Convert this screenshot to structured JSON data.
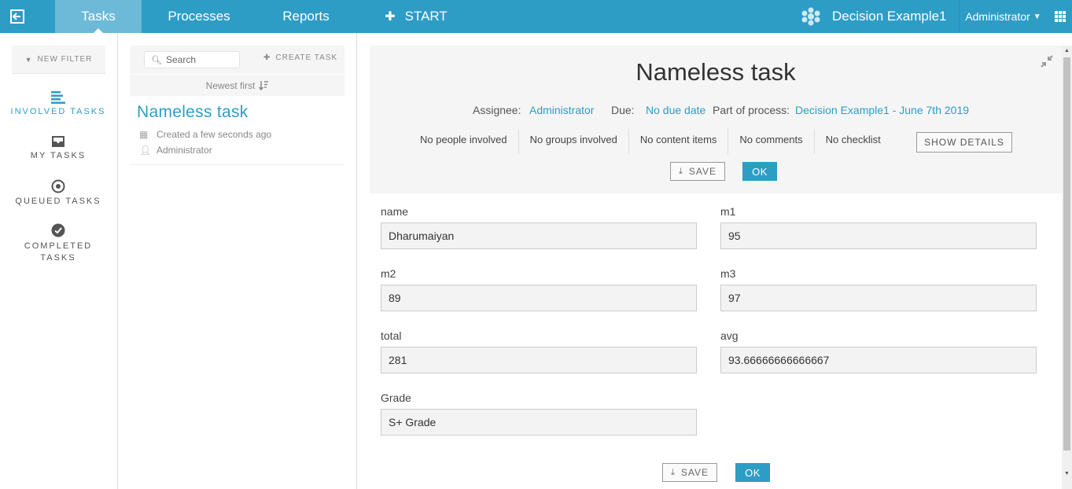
{
  "topbar": {
    "tabs": [
      {
        "label": "Tasks",
        "active": true
      },
      {
        "label": "Processes"
      },
      {
        "label": "Reports"
      }
    ],
    "start_label": "START",
    "app_title": "Decision Example1",
    "user_label": "Administrator",
    "icons": [
      "back-icon",
      "plus-icon",
      "app-logo-icon",
      "chevron-down-icon",
      "apps-grid-icon"
    ],
    "colors": {
      "bar": "#2d9dc5",
      "active_tab": "#6cbad8"
    }
  },
  "sidebar": {
    "new_filter_label": "NEW FILTER",
    "items": [
      {
        "label": "INVOLVED TASKS",
        "icon": "list-icon",
        "active": true
      },
      {
        "label": "MY TASKS",
        "icon": "inbox-icon"
      },
      {
        "label": "QUEUED TASKS",
        "icon": "target-icon"
      },
      {
        "label": "COMPLETED",
        "label2": "TASKS",
        "icon": "check-circle-icon"
      }
    ]
  },
  "tasklist": {
    "search_placeholder": "Search",
    "create_task_label": "CREATE TASK",
    "sort_label": "Newest first",
    "tasks": [
      {
        "title": "Nameless task",
        "created": "Created a few seconds ago",
        "assignee": "Administrator"
      }
    ]
  },
  "detail": {
    "title": "Nameless task",
    "assignee_label": "Assignee:",
    "assignee_value": "Administrator",
    "due_label": "Due:",
    "due_value": "No due date",
    "process_label": "Part of process:",
    "process_value": "Decision Example1 - June 7th 2019",
    "counts": [
      "No people involved",
      "No groups involved",
      "No content items",
      "No comments",
      "No checklist"
    ],
    "show_details_label": "SHOW DETAILS",
    "save_label": "SAVE",
    "ok_label": "OK"
  },
  "form": {
    "fields": [
      {
        "label": "name",
        "value": "Dharumaiyan"
      },
      {
        "label": "m1",
        "value": "95"
      },
      {
        "label": "m2",
        "value": "89"
      },
      {
        "label": "m3",
        "value": "97"
      },
      {
        "label": "total",
        "value": "281"
      },
      {
        "label": "avg",
        "value": "93.66666666666667"
      },
      {
        "label": "Grade",
        "value": "S+ Grade"
      }
    ],
    "save_label": "SAVE",
    "ok_label": "OK"
  }
}
